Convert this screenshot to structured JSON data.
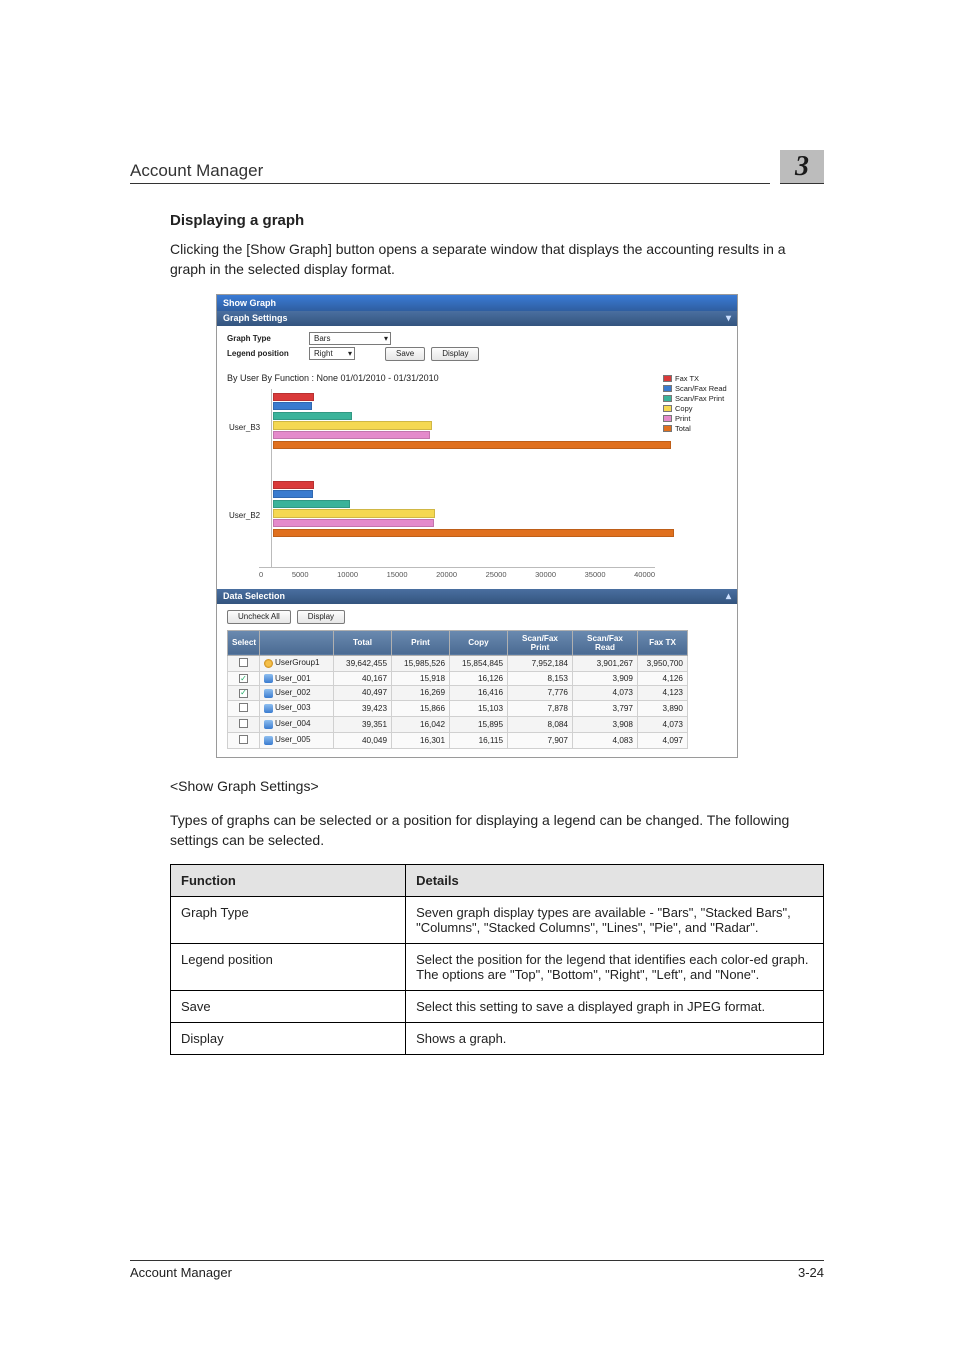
{
  "header": {
    "running_head": "Account Manager",
    "chapter_number": "3"
  },
  "section": {
    "title": "Displaying a graph",
    "intro": "Clicking the [Show Graph] button opens a separate window that displays the accounting results in a graph in the selected display format."
  },
  "screenshot": {
    "window_title": "Show Graph",
    "panels": {
      "graph_settings": {
        "heading": "Graph Settings",
        "graph_type_label": "Graph Type",
        "graph_type_value": "Bars",
        "legend_position_label": "Legend position",
        "legend_position_value": "Right",
        "save_label": "Save",
        "display_label": "Display"
      },
      "data_selection": {
        "heading": "Data Selection",
        "uncheck_all_label": "Uncheck All",
        "display_label": "Display"
      }
    },
    "chart": {
      "title": "By User  By Function : None  01/01/2010 - 01/31/2010",
      "legend": [
        {
          "label": "Fax TX",
          "color": "#d93a3a"
        },
        {
          "label": "Scan/Fax Read",
          "color": "#3a7bcf"
        },
        {
          "label": "Scan/Fax Print",
          "color": "#3bb39a"
        },
        {
          "label": "Copy",
          "color": "#f5d852"
        },
        {
          "label": "Print",
          "color": "#e48acb"
        },
        {
          "label": "Total",
          "color": "#e0701e"
        }
      ],
      "groups": [
        {
          "label": "User_B3"
        },
        {
          "label": "User_B2"
        }
      ],
      "x_ticks": [
        "0",
        "5000",
        "10000",
        "15000",
        "20000",
        "25000",
        "30000",
        "35000",
        "40000"
      ]
    },
    "table": {
      "columns": [
        "Select",
        "",
        "Total",
        "Print",
        "Copy",
        "Scan/Fax Print",
        "Scan/Fax Read",
        "Fax TX"
      ],
      "rows": [
        {
          "checked": false,
          "icon": "group",
          "name": "UserGroup1",
          "values": [
            "39,642,455",
            "15,985,526",
            "15,854,845",
            "7,952,184",
            "3,901,267",
            "3,950,700"
          ]
        },
        {
          "checked": true,
          "icon": "user",
          "name": "User_001",
          "values": [
            "40,167",
            "15,918",
            "16,126",
            "8,153",
            "3,909",
            "4,126"
          ]
        },
        {
          "checked": true,
          "icon": "user",
          "name": "User_002",
          "values": [
            "40,497",
            "16,269",
            "16,416",
            "7,776",
            "4,073",
            "4,123"
          ]
        },
        {
          "checked": false,
          "icon": "user",
          "name": "User_003",
          "values": [
            "39,423",
            "15,866",
            "15,103",
            "7,878",
            "3,797",
            "3,890"
          ]
        },
        {
          "checked": false,
          "icon": "user",
          "name": "User_004",
          "values": [
            "39,351",
            "16,042",
            "15,895",
            "8,084",
            "3,908",
            "4,073"
          ]
        },
        {
          "checked": false,
          "icon": "user",
          "name": "User_005",
          "values": [
            "40,049",
            "16,301",
            "16,115",
            "7,907",
            "4,083",
            "4,097"
          ]
        }
      ]
    }
  },
  "chart_data": {
    "type": "bar",
    "orientation": "horizontal",
    "title": "By User  By Function : None  01/01/2010 - 01/31/2010",
    "xlabel": "",
    "ylabel": "",
    "xlim": [
      0,
      40000
    ],
    "categories": [
      "User_B3",
      "User_B2"
    ],
    "series": [
      {
        "name": "Fax TX",
        "color": "#d93a3a",
        "values": [
          4100,
          4100
        ]
      },
      {
        "name": "Scan/Fax Read",
        "color": "#3a7bcf",
        "values": [
          3900,
          4000
        ]
      },
      {
        "name": "Scan/Fax Print",
        "color": "#3bb39a",
        "values": [
          8000,
          7800
        ]
      },
      {
        "name": "Copy",
        "color": "#f5d852",
        "values": [
          16100,
          16400
        ]
      },
      {
        "name": "Print",
        "color": "#e48acb",
        "values": [
          15900,
          16300
        ]
      },
      {
        "name": "Total",
        "color": "#e0701e",
        "values": [
          40200,
          40500
        ]
      }
    ],
    "x_ticks": [
      0,
      5000,
      10000,
      15000,
      20000,
      25000,
      30000,
      35000,
      40000
    ]
  },
  "settings_heading": "<Show Graph Settings>",
  "settings_intro": "Types of graphs can be selected or a position for displaying a legend can be changed. The following settings can be selected.",
  "settings_table": {
    "head": {
      "function": "Function",
      "details": "Details"
    },
    "rows": [
      {
        "function": "Graph Type",
        "details": "Seven graph display types are available - \"Bars\", \"Stacked Bars\", \"Columns\", \"Stacked Columns\", \"Lines\", \"Pie\", and \"Radar\"."
      },
      {
        "function": "Legend position",
        "details": "Select the position for the legend that identifies each color-ed graph. The options are \"Top\", \"Bottom\", \"Right\", \"Left\", and \"None\"."
      },
      {
        "function": "Save",
        "details": "Select this setting to save a displayed graph in JPEG format."
      },
      {
        "function": "Display",
        "details": "Shows a graph."
      }
    ]
  },
  "footer": {
    "left": "Account Manager",
    "right": "3-24"
  }
}
